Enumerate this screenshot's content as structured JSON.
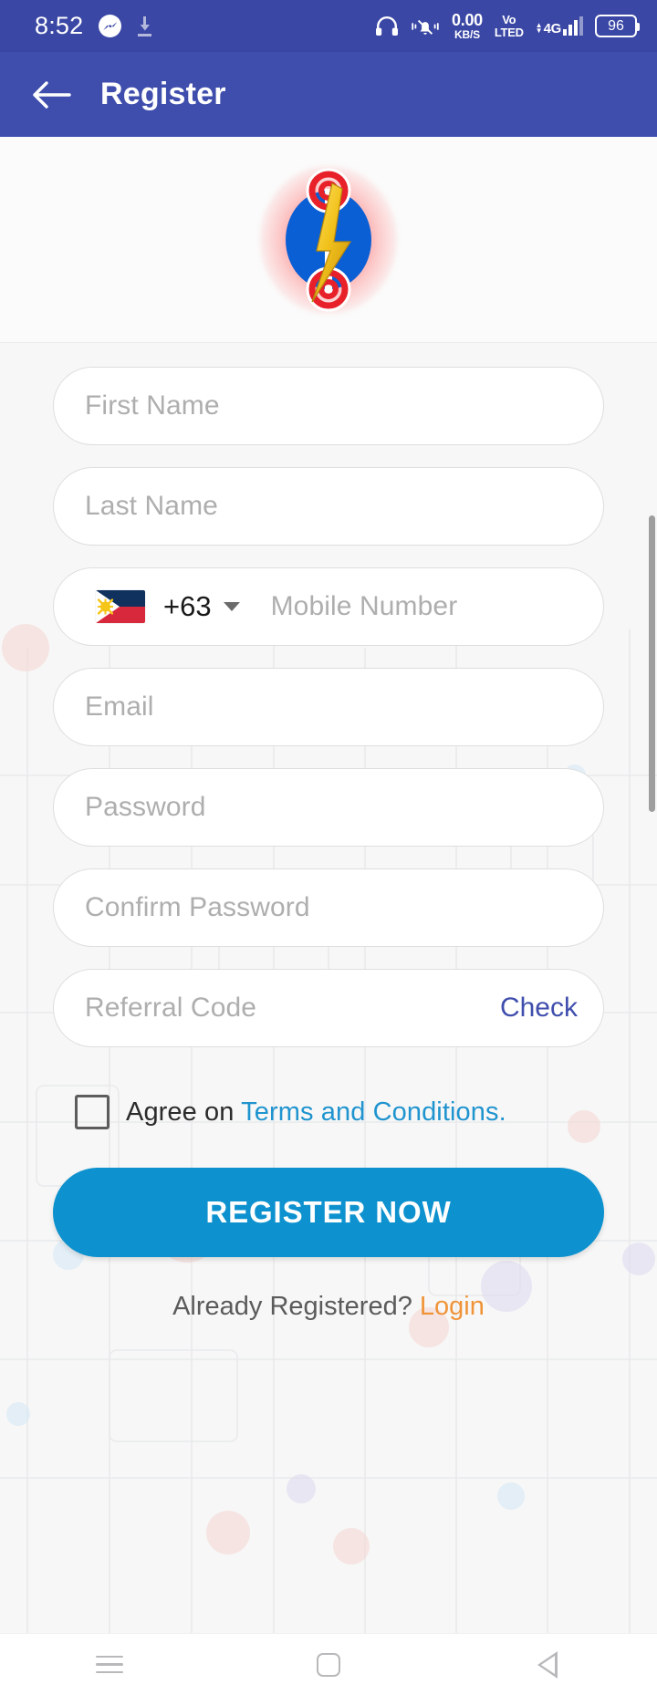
{
  "status_bar": {
    "time": "8:52",
    "messenger_icon": "messenger-icon",
    "download_icon": "download-icon",
    "headset_icon": "headset-icon",
    "silent_icon": "bell-vibrate-off-icon",
    "net_speed_value": "0.00",
    "net_speed_unit": "KB/S",
    "volte_top": "Vo",
    "volte_bottom": "LTED",
    "network_type": "4G",
    "battery_level": "96",
    "background_color": "#3a47a5"
  },
  "app_bar": {
    "back_icon": "arrow-left-icon",
    "title": "Register",
    "background_color": "#3f4ead"
  },
  "logo": {
    "name": "lightning-bolt-logo",
    "disc_color": "#0b5fd4",
    "bolt_color": "#efc01e",
    "ring_color": "#e8202a",
    "glow_color": "#ff6b6b"
  },
  "form": {
    "fields": [
      {
        "name": "first-name-input",
        "placeholder": "First Name",
        "value": ""
      },
      {
        "name": "last-name-input",
        "placeholder": "Last Name",
        "value": ""
      },
      {
        "name": "mobile-number-input",
        "placeholder": "Mobile Number",
        "value": ""
      },
      {
        "name": "email-input",
        "placeholder": "Email",
        "value": ""
      },
      {
        "name": "password-input",
        "placeholder": "Password",
        "value": ""
      },
      {
        "name": "confirm-password-input",
        "placeholder": "Confirm Password",
        "value": ""
      },
      {
        "name": "referral-code-input",
        "placeholder": "Referral Code",
        "value": ""
      }
    ],
    "country": {
      "flag": "philippines-flag-icon",
      "dial_code": "+63",
      "dropdown_icon": "chevron-down-icon"
    },
    "check_label": "Check",
    "check_color": "#3f4ead"
  },
  "terms": {
    "checked": false,
    "prefix": "Agree on ",
    "link": "Terms and Conditions.",
    "link_color": "#2094cf"
  },
  "primary_action": {
    "label": "REGISTER NOW",
    "color": "#0d92cf"
  },
  "footer": {
    "prompt": "Already Registered? ",
    "link": "Login",
    "link_color": "#f0943a"
  },
  "nav_bar": {
    "recents_icon": "menu-icon",
    "home_icon": "home-square-icon",
    "back_icon": "back-triangle-icon"
  }
}
